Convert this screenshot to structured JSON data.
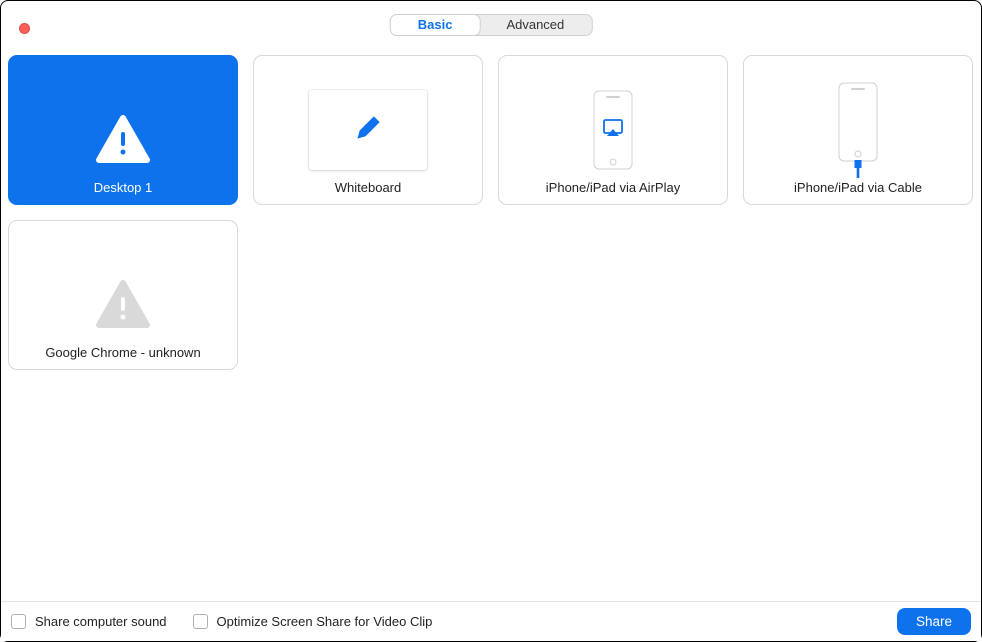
{
  "close_button": "close",
  "tabs": {
    "basic": "Basic",
    "advanced": "Advanced"
  },
  "cards": {
    "desktop": "Desktop 1",
    "whiteboard": "Whiteboard",
    "airplay": "iPhone/iPad via AirPlay",
    "cable": "iPhone/iPad via Cable",
    "chrome": "Google Chrome - unknown"
  },
  "footer": {
    "share_sound": "Share computer sound",
    "optimize_video": "Optimize Screen Share for Video Clip",
    "share_button": "Share"
  },
  "colors": {
    "accent": "#0e72ed"
  }
}
